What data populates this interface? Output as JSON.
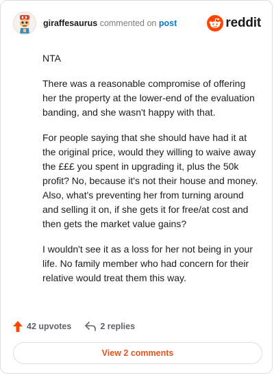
{
  "header": {
    "username": "giraffesaurus",
    "action_text": "commented on",
    "post_link": "post",
    "brand": "reddit"
  },
  "comment": {
    "paragraphs": [
      "NTA",
      "There was a reasonable compromise of offering her the property at the lower-end of the evaluation banding, and she wasn't happy with that.",
      "For people saying that she should have had it at the original price, would they willing to waive away the £££ you spent in upgrading it, plus the 50k profit? No, because it's not their house and money. Also, what's preventing her from turning around and selling it on, if she gets it for free/at cost and then gets the market value gains?",
      "I wouldn't see it as a loss for her not being in your life. No family member who had concern for their relative would treat them this way."
    ]
  },
  "footer": {
    "upvotes": "42 upvotes",
    "replies": "2 replies",
    "view_comments": "View 2 comments"
  },
  "colors": {
    "accent": "#ff4500",
    "link": "#0079d3",
    "button_text": "#e0541d"
  }
}
